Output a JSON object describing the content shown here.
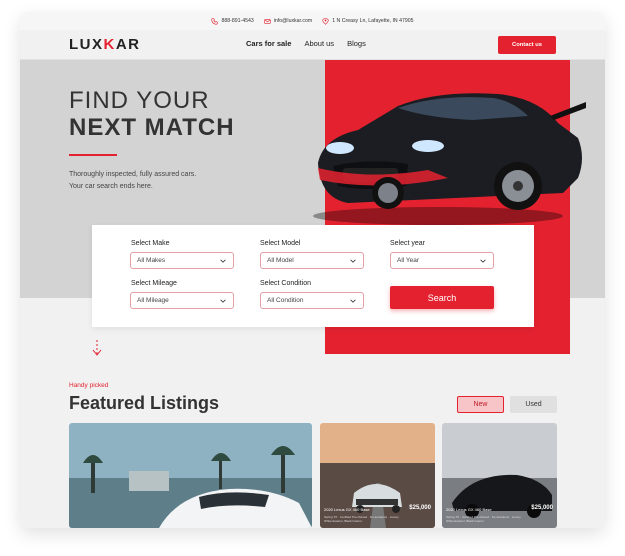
{
  "topbar": {
    "phone": "888-891-4543",
    "email": "info@luxkar.com",
    "address": "1 N Creasy Ln, Lafayette, IN 47905"
  },
  "brand": {
    "logo_pre": "LUX",
    "logo_k": "K",
    "logo_post": "AR",
    "accent": "#e4222f"
  },
  "nav": {
    "items": [
      {
        "label": "Cars for sale"
      },
      {
        "label": "About us"
      },
      {
        "label": "Blogs"
      }
    ],
    "contact_label": "Contact us"
  },
  "hero": {
    "title_line1": "FIND YOUR",
    "title_line2": "NEXT MATCH",
    "subtitle_line1": "Thoroughly inspected, fully assured cars.",
    "subtitle_line2": "Your car search ends here."
  },
  "search": {
    "make_label": "Select Make",
    "make_value": "All Makes",
    "model_label": "Select Model",
    "model_value": "All Model",
    "year_label": "Select year",
    "year_value": "All Year",
    "mileage_label": "Select Mileage",
    "mileage_value": "All Mileage",
    "condition_label": "Select Condition",
    "condition_value": "All Condition",
    "button_label": "Search"
  },
  "featured": {
    "eyebrow": "Handy picked",
    "title": "Featured Listings",
    "tab_new": "New",
    "tab_used": "Used",
    "cards": [
      {
        "title": "2020 Lexus GX 460 Base",
        "price": "$25,000",
        "meta": "Spring TX · Certified Pre-Owned · No accidents · Luxury White Exterior, Black Interior"
      },
      {
        "title": "2020 Lexus GX 460 Base",
        "price": "$25,000",
        "meta": "Spring TX · Certified Pre-Owned · No accidents · Luxury White Exterior, Black Interior"
      }
    ]
  }
}
